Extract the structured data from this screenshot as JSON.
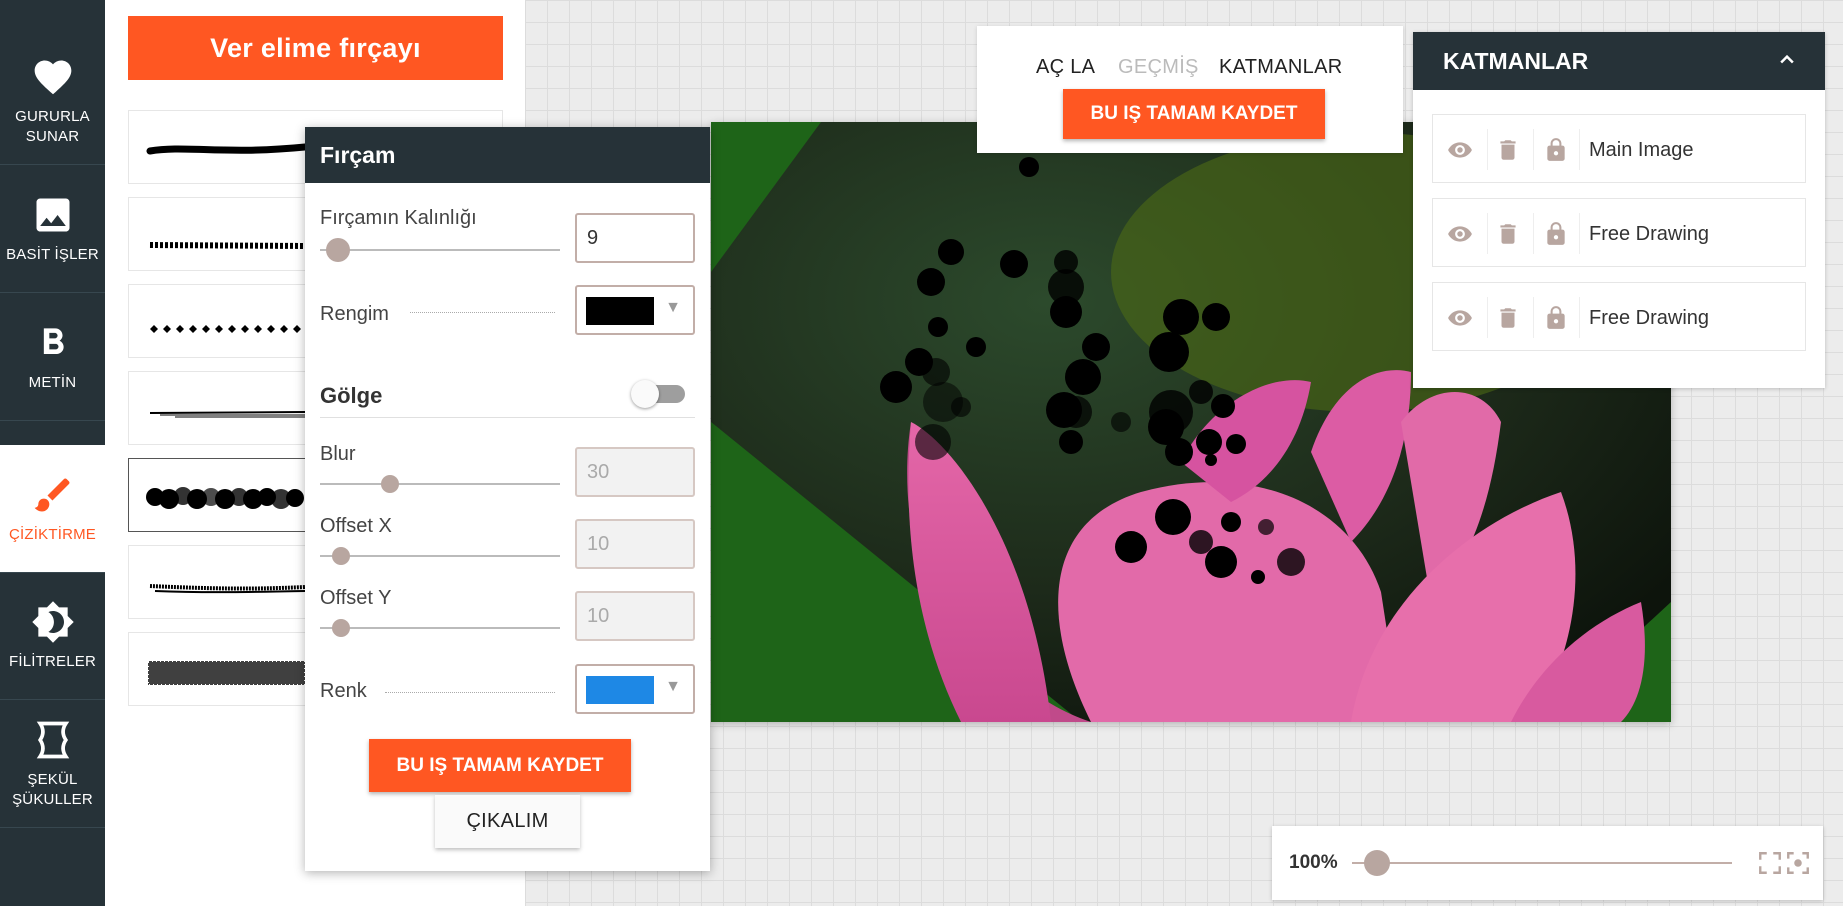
{
  "sidebar": {
    "items": [
      {
        "label_line1": "GURURLA",
        "label_line2": "SUNAR",
        "icon": "heart-icon"
      },
      {
        "label_line1": "BASİT İŞLER",
        "label_line2": "",
        "icon": "image-icon"
      },
      {
        "label_line1": "METİN",
        "label_line2": "",
        "icon": "bold-icon"
      },
      {
        "label_line1": "ÇİZİKTİRME",
        "label_line2": "",
        "icon": "brush-icon",
        "active": true
      },
      {
        "label_line1": "FİLİTRELER",
        "label_line2": "",
        "icon": "brightness-icon"
      },
      {
        "label_line1": "ŞEKÜL",
        "label_line2": "ŞÜKULLER",
        "icon": "shape-icon"
      }
    ]
  },
  "brush_panel": {
    "header_button": "Ver elime fırçayı",
    "brush_count": 7,
    "selected_index": 4
  },
  "brush_popup": {
    "title": "Fırçam",
    "thickness_label": "Fırçamın Kalınlığı",
    "thickness_value": "9",
    "color_label": "Rengim",
    "color_value": "#000000",
    "shadow_label": "Gölge",
    "shadow_enabled": false,
    "blur_label": "Blur",
    "blur_value": "30",
    "offset_x_label": "Offset X",
    "offset_x_value": "10",
    "offset_y_label": "Offset Y",
    "offset_y_value": "10",
    "shadow_color_label": "Renk",
    "shadow_color_value": "#1e88e5",
    "save_button": "BU IŞ TAMAM KAYDET",
    "cancel_button": "ÇIKALIM"
  },
  "top_menu": {
    "tabs": [
      {
        "label": "AÇ LA",
        "enabled": true
      },
      {
        "label": "GEÇMİŞ",
        "enabled": false
      },
      {
        "label": "KATMANLAR",
        "enabled": true
      }
    ],
    "save_button": "BU IŞ TAMAM KAYDET"
  },
  "layers_panel": {
    "title": "KATMANLAR",
    "layers": [
      {
        "name": "Main Image"
      },
      {
        "name": "Free Drawing"
      },
      {
        "name": "Free Drawing"
      }
    ]
  },
  "zoom": {
    "label": "100%",
    "level_fraction": 0.05
  },
  "colors": {
    "accent": "#ff5722",
    "dark": "#263238",
    "canvas_green": "#1e6418",
    "flower_pink": "#e65fa8"
  }
}
